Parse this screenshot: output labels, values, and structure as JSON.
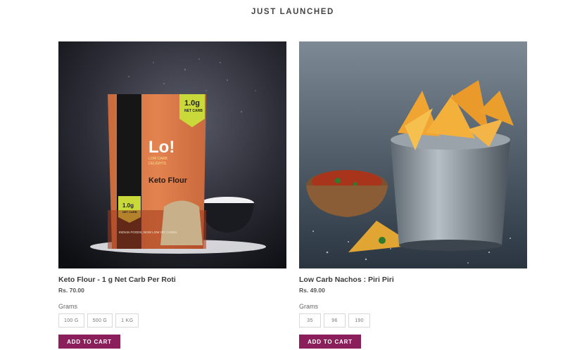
{
  "section": {
    "title": "JUST LAUNCHED"
  },
  "products": [
    {
      "name": "Keto Flour - 1 g Net Carb Per Roti",
      "price": "Rs. 70.00",
      "variant_label": "Grams",
      "options": [
        "100 G",
        "500 G",
        "1 KG"
      ],
      "cart_label": "ADD TO CART",
      "image": {
        "brand": "Lo!",
        "tagline1": "LOW CARB",
        "tagline2": "DELIGHTS",
        "badge_top": "1.0g",
        "badge_sub": "NET CARB",
        "product_name": "Keto Flour",
        "badge_bottom": "1.0g",
        "badge_bottom_sub": "NET CARB",
        "pouch_footer": "INDIAN FOODS, NOW LOW ON CARBS"
      }
    },
    {
      "name": "Low Carb Nachos : Piri Piri",
      "price": "Rs. 49.00",
      "variant_label": "Grams",
      "options": [
        "35",
        "96",
        "190"
      ],
      "cart_label": "ADD TO CART"
    }
  ],
  "colors": {
    "accent": "#8a1f5c"
  }
}
